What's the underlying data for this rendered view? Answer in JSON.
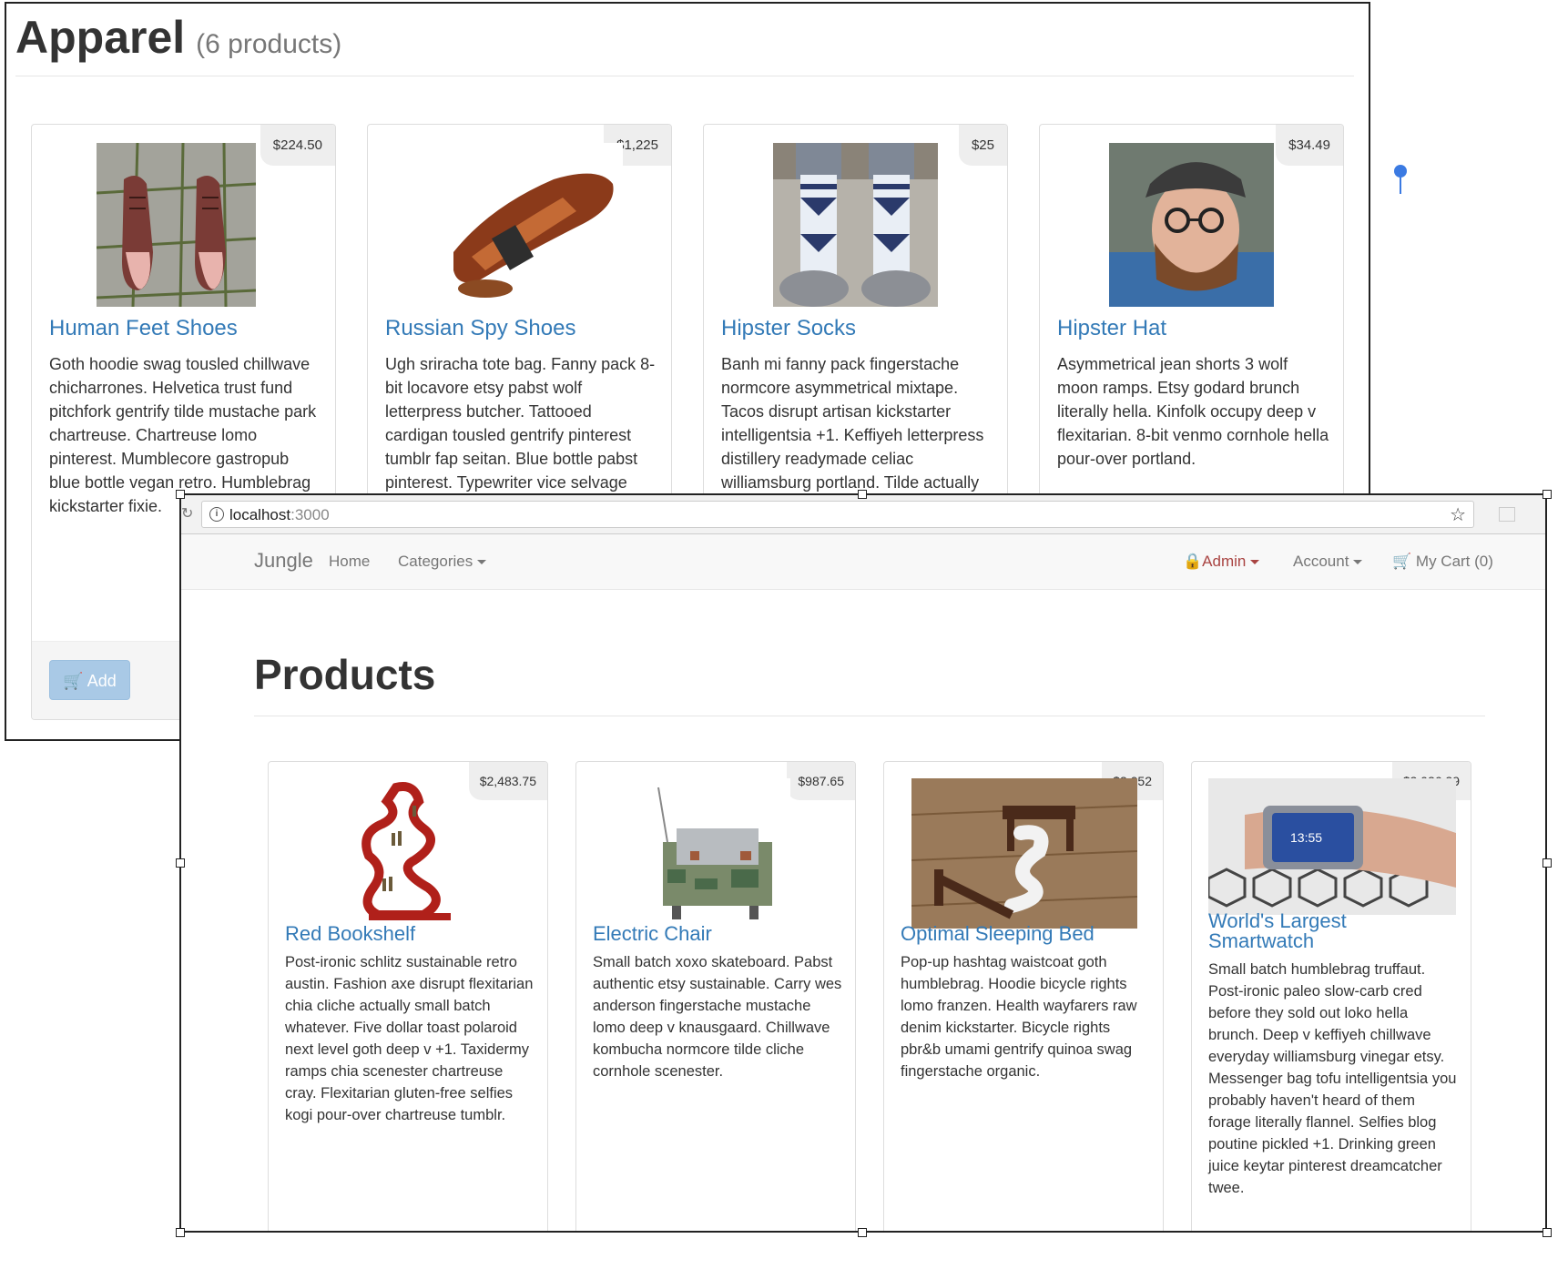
{
  "apparel": {
    "title": "Apparel",
    "count": "(6 products)",
    "add_label": "Add",
    "products": [
      {
        "name": "Human Feet Shoes",
        "price": "$224.50",
        "description": "Goth hoodie swag tousled chillwave chicharrones. Helvetica trust fund pitchfork gentrify tilde mustache park chartreuse. Chartreuse lomo pinterest. Mumblecore gastropub blue bottle vegan retro. Humblebrag kickstarter fixie."
      },
      {
        "name": "Russian Spy Shoes",
        "price": "$1,225",
        "description": "Ugh sriracha tote bag. Fanny pack 8-bit locavore etsy pabst wolf letterpress butcher. Tattooed cardigan tousled gentrify pinterest tumblr fap seitan. Blue bottle pabst pinterest. Typewriter vice selvage"
      },
      {
        "name": "Hipster Socks",
        "price": "$25",
        "description": "Banh mi fanny pack fingerstache normcore asymmetrical mixtape. Tacos disrupt artisan kickstarter intelligentsia +1. Keffiyeh letterpress distillery readymade celiac williamsburg portland. Tilde actually"
      },
      {
        "name": "Hipster Hat",
        "price": "$34.49",
        "description": "Asymmetrical jean shorts 3 wolf moon ramps. Etsy godard brunch literally hella. Kinfolk occupy deep v flexitarian. 8-bit venmo cornhole hella pour-over portland."
      }
    ]
  },
  "browser": {
    "url_host": "localhost",
    "url_port": ":3000"
  },
  "navbar": {
    "brand": "Jungle",
    "home": "Home",
    "categories": "Categories",
    "admin": "Admin",
    "account": "Account",
    "cart": "My Cart (0)"
  },
  "products_page": {
    "title": "Products",
    "products": [
      {
        "name": "Red Bookshelf",
        "price": "$2,483.75",
        "description": "Post-ironic schlitz sustainable retro austin. Fashion axe disrupt flexitarian chia cliche actually small batch whatever. Five dollar toast polaroid next level goth deep v +1. Taxidermy ramps chia scenester chartreuse cray. Flexitarian gluten-free selfies kogi pour-over chartreuse tumblr."
      },
      {
        "name": "Electric Chair",
        "price": "$987.65",
        "description": "Small batch xoxo skateboard. Pabst authentic etsy sustainable. Carry wes anderson fingerstache mustache lomo deep v knausgaard. Chillwave kombucha normcore tilde cliche cornhole scenester."
      },
      {
        "name": "Optimal Sleeping Bed",
        "price": "$3,052",
        "description": "Pop-up hashtag waistcoat goth humblebrag. Hoodie bicycle rights lomo franzen. Health wayfarers raw denim kickstarter. Bicycle rights pbr&b umami gentrify quinoa swag fingerstache organic."
      },
      {
        "name": "World's Largest Smartwatch",
        "price": "$2,026.29",
        "description": "Small batch humblebrag truffaut. Post-ironic paleo slow-carb cred before they sold out loko hella brunch. Deep v keffiyeh chillwave everyday williamsburg vinegar etsy. Messenger bag tofu intelligentsia you probably haven't heard of them forage literally flannel. Selfies blog poutine pickled +1. Drinking green juice keytar pinterest dreamcatcher twee."
      }
    ]
  },
  "colors": {
    "link": "#337ab7",
    "admin": "#a94442",
    "add_button": "#a9c9e6",
    "price_badge": "#eeeeee",
    "pin": "#3b7ae2"
  },
  "icons": {
    "cart": "shopping-cart-icon",
    "lock": "lock-icon",
    "star": "bookmark-star-icon",
    "info": "info-icon"
  }
}
